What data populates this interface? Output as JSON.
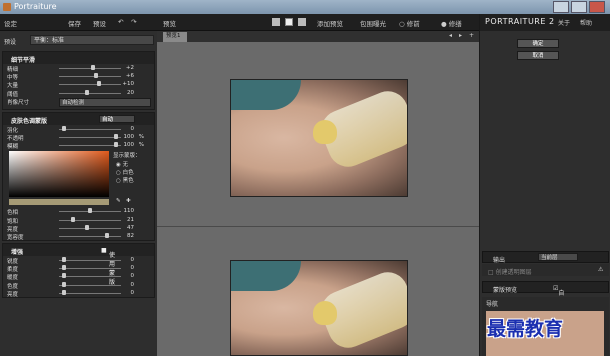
{
  "app": {
    "title": "Portraiture"
  },
  "left": {
    "toolbar": {
      "settings": "设定",
      "save": "保存",
      "preset": "预设",
      "undo": "↶",
      "redo": "↷"
    },
    "preset_label": "预设",
    "preset_value": "平衡：标准",
    "detail": {
      "title": "细节平滑",
      "rows": [
        {
          "label": "精细",
          "value": "+2",
          "pos": 0.55
        },
        {
          "label": "中等",
          "value": "+6",
          "pos": 0.6
        },
        {
          "label": "大量",
          "value": "+10",
          "pos": 0.65
        },
        {
          "label": "阈值",
          "value": "20",
          "pos": 0.45
        }
      ],
      "size_label": "肖像尺寸",
      "size_value": "自动检测"
    },
    "skin": {
      "title": "皮肤色调蒙版",
      "mode": "自动",
      "rows": [
        {
          "label": "羽化",
          "value": "0",
          "unit": "",
          "pos": 0.05
        },
        {
          "label": "不透明",
          "value": "100",
          "unit": "%",
          "pos": 0.95
        },
        {
          "label": "模糊",
          "value": "100",
          "unit": "%",
          "pos": 0.95
        }
      ],
      "show_mask": "显示蒙版：",
      "options": [
        "无",
        "白色",
        "黑色"
      ],
      "hsl": [
        {
          "label": "色相",
          "value": "110",
          "pos": 0.5
        },
        {
          "label": "饱和",
          "value": "21",
          "pos": 0.2
        },
        {
          "label": "亮度",
          "value": "47",
          "pos": 0.45
        },
        {
          "label": "宽容度",
          "value": "82",
          "pos": 0.8
        }
      ]
    },
    "enhance": {
      "title": "增强",
      "use_mask": "使用蒙版",
      "rows": [
        {
          "label": "锐度",
          "value": "0"
        },
        {
          "label": "柔度",
          "value": "0"
        },
        {
          "label": "暖度",
          "value": "0"
        },
        {
          "label": "色度",
          "value": "0"
        },
        {
          "label": "亮度",
          "value": "0"
        }
      ]
    }
  },
  "center": {
    "toolbar": {
      "preview": "预览",
      "add_preview": "添加预览",
      "clip": "包围曝光",
      "before": "○ 修前",
      "after": "● 修缮"
    },
    "tab": "预览1"
  },
  "right": {
    "brand": "PORTRAITURE 2",
    "about": "关于",
    "help": "帮助",
    "ok": "确定",
    "cancel": "取消",
    "output": "输出",
    "output_value": "当前层",
    "create_layer": "创建透明图层",
    "mask_preview": "蒙版预览",
    "auto_open": "自动展开",
    "nav": "导航"
  },
  "watermark": "最需教育"
}
